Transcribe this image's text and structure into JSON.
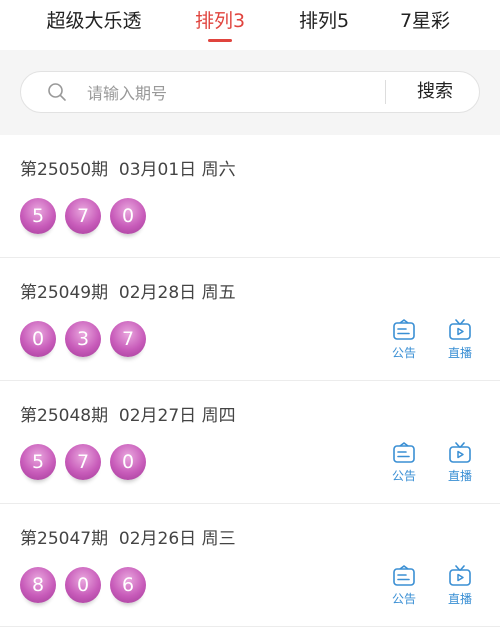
{
  "tabs": [
    {
      "label": "超级大乐透",
      "active": false
    },
    {
      "label": "排列3",
      "active": true
    },
    {
      "label": "排列5",
      "active": false
    },
    {
      "label": "7星彩",
      "active": false
    }
  ],
  "search": {
    "placeholder": "请输入期号",
    "button_label": "搜索"
  },
  "colors": {
    "accent": "#e0443e",
    "ball": "#c85cba",
    "action": "#3a8fd4"
  },
  "draws": [
    {
      "issue": "第25050期",
      "date": "03月01日",
      "weekday": "周六",
      "numbers": [
        "5",
        "7",
        "0"
      ],
      "has_actions": false
    },
    {
      "issue": "第25049期",
      "date": "02月28日",
      "weekday": "周五",
      "numbers": [
        "0",
        "3",
        "7"
      ],
      "has_actions": true
    },
    {
      "issue": "第25048期",
      "date": "02月27日",
      "weekday": "周四",
      "numbers": [
        "5",
        "7",
        "0"
      ],
      "has_actions": true
    },
    {
      "issue": "第25047期",
      "date": "02月26日",
      "weekday": "周三",
      "numbers": [
        "8",
        "0",
        "6"
      ],
      "has_actions": true
    }
  ],
  "actions": {
    "notice_label": "公告",
    "notice_icon": "notice-icon",
    "live_label": "直播",
    "live_icon": "tv-icon"
  }
}
